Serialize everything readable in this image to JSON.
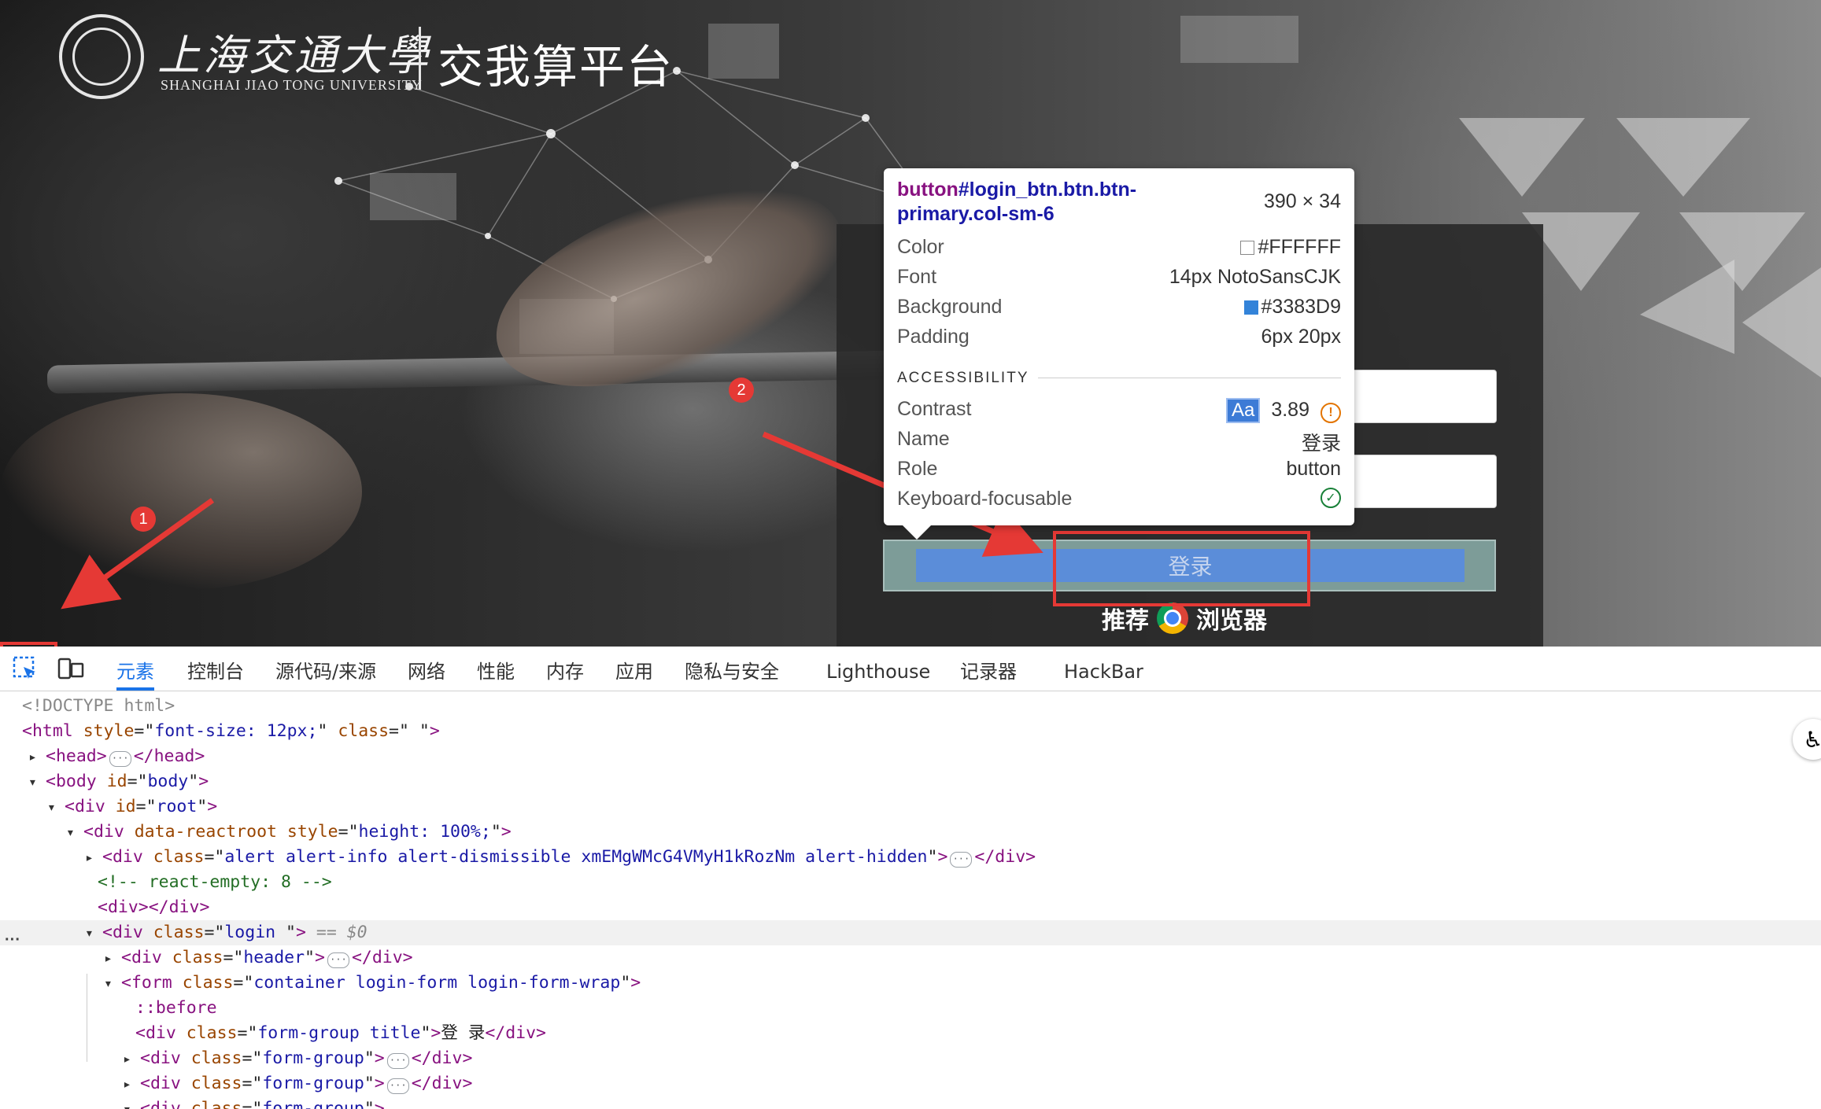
{
  "header": {
    "university_cn": "上海交通大學",
    "university_en": "SHANGHAI JIAO TONG UNIVERSITY",
    "platform_title": "交我算平台"
  },
  "login": {
    "button_label": "登录",
    "browser_hint_left": "推荐",
    "browser_hint_right": "浏览器"
  },
  "annotations": {
    "marker1": "1",
    "marker2": "2",
    "accent_color": "#E53935"
  },
  "tooltip": {
    "selector_tag": "button",
    "selector_rest": "#login_btn.btn.btn-primary.col-sm-6",
    "size": "390 × 34",
    "rows": [
      {
        "key": "Color",
        "value": "#FFFFFF",
        "swatch": "#FFFFFF"
      },
      {
        "key": "Font",
        "value": "14px NotoSansCJK"
      },
      {
        "key": "Background",
        "value": "#3383D9",
        "swatch": "#3383D9"
      },
      {
        "key": "Padding",
        "value": "6px 20px"
      }
    ],
    "accessibility_title": "ACCESSIBILITY",
    "contrast_label": "Contrast",
    "contrast_badge": "Aa",
    "contrast_value": "3.89",
    "name_label": "Name",
    "name_value": "登录",
    "role_label": "Role",
    "role_value": "button",
    "keyboard_label": "Keyboard-focusable"
  },
  "devtools": {
    "tabs": [
      "元素",
      "控制台",
      "源代码/来源",
      "网络",
      "性能",
      "内存",
      "应用",
      "隐私与安全",
      "Lighthouse",
      "记录器",
      "HackBar"
    ],
    "active_tab": "元素",
    "dom": {
      "doctype": "<!DOCTYPE html>",
      "html_tag": "html",
      "html_style": "font-size: 12px;",
      "html_class": " ",
      "head": "head",
      "body_id": "body",
      "root_id": "root",
      "reactroot_style": "height: 100%;",
      "alert_class": "alert alert-info alert-dismissible xmEMgWMcG4VMyH1kRozNm alert-hidden",
      "comment": "<!-- react-empty: 8 -->",
      "empty_div": "<div></div>",
      "login_class": "login ",
      "selected_suffix": "== $0",
      "header_class": "header",
      "form_class": "container login-form login-form-wrap",
      "before": "::before",
      "title_class": "form-group title",
      "title_text": "登 录",
      "form_group_class": "form-group"
    }
  }
}
